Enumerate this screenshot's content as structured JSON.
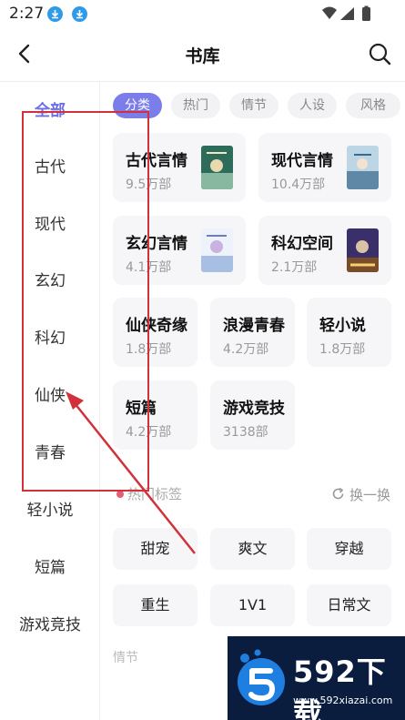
{
  "status_bar": {
    "time": "2:27",
    "download_icons": [
      "download-icon",
      "download-icon"
    ],
    "icons": [
      "wifi-icon",
      "signal-icon",
      "battery-icon"
    ]
  },
  "nav": {
    "title": "书库",
    "back_icon": "chevron-left-icon",
    "search_icon": "search-icon"
  },
  "sidebar": {
    "items": [
      {
        "label": "全部",
        "active": true
      },
      {
        "label": "古代",
        "active": false
      },
      {
        "label": "现代",
        "active": false
      },
      {
        "label": "玄幻",
        "active": false
      },
      {
        "label": "科幻",
        "active": false
      },
      {
        "label": "仙侠",
        "active": false
      },
      {
        "label": "青春",
        "active": false
      },
      {
        "label": "轻小说",
        "active": false
      },
      {
        "label": "短篇",
        "active": false
      },
      {
        "label": "游戏竞技",
        "active": false
      }
    ]
  },
  "filters": [
    {
      "label": "分类",
      "active": true
    },
    {
      "label": "热门",
      "active": false
    },
    {
      "label": "情节",
      "active": false
    },
    {
      "label": "人设",
      "active": false
    },
    {
      "label": "风格",
      "active": false
    }
  ],
  "categories": [
    {
      "title": "古代言情",
      "count": "9.5万部"
    },
    {
      "title": "现代言情",
      "count": "10.4万部"
    },
    {
      "title": "玄幻言情",
      "count": "4.1万部"
    },
    {
      "title": "科幻空间",
      "count": "2.1万部"
    },
    {
      "title": "仙侠奇缘",
      "count": "1.8万部"
    },
    {
      "title": "浪漫青春",
      "count": "4.2万部"
    },
    {
      "title": "轻小说",
      "count": "1.8万部"
    },
    {
      "title": "短篇",
      "count": "4.2万部"
    },
    {
      "title": "游戏竞技",
      "count": "3138部"
    }
  ],
  "hot_tags": {
    "title": "热门标签",
    "refresh_label": "换一换",
    "tags": [
      "甜宠",
      "爽文",
      "穿越",
      "重生",
      "1V1",
      "日常文"
    ]
  },
  "next_section": "情节",
  "watermark": {
    "brand": "592下载",
    "url": "www.592xiazai.com"
  },
  "colors": {
    "accent": "#7b7ee8",
    "annotation": "#d2313b",
    "card_bg": "#f6f6f8"
  }
}
